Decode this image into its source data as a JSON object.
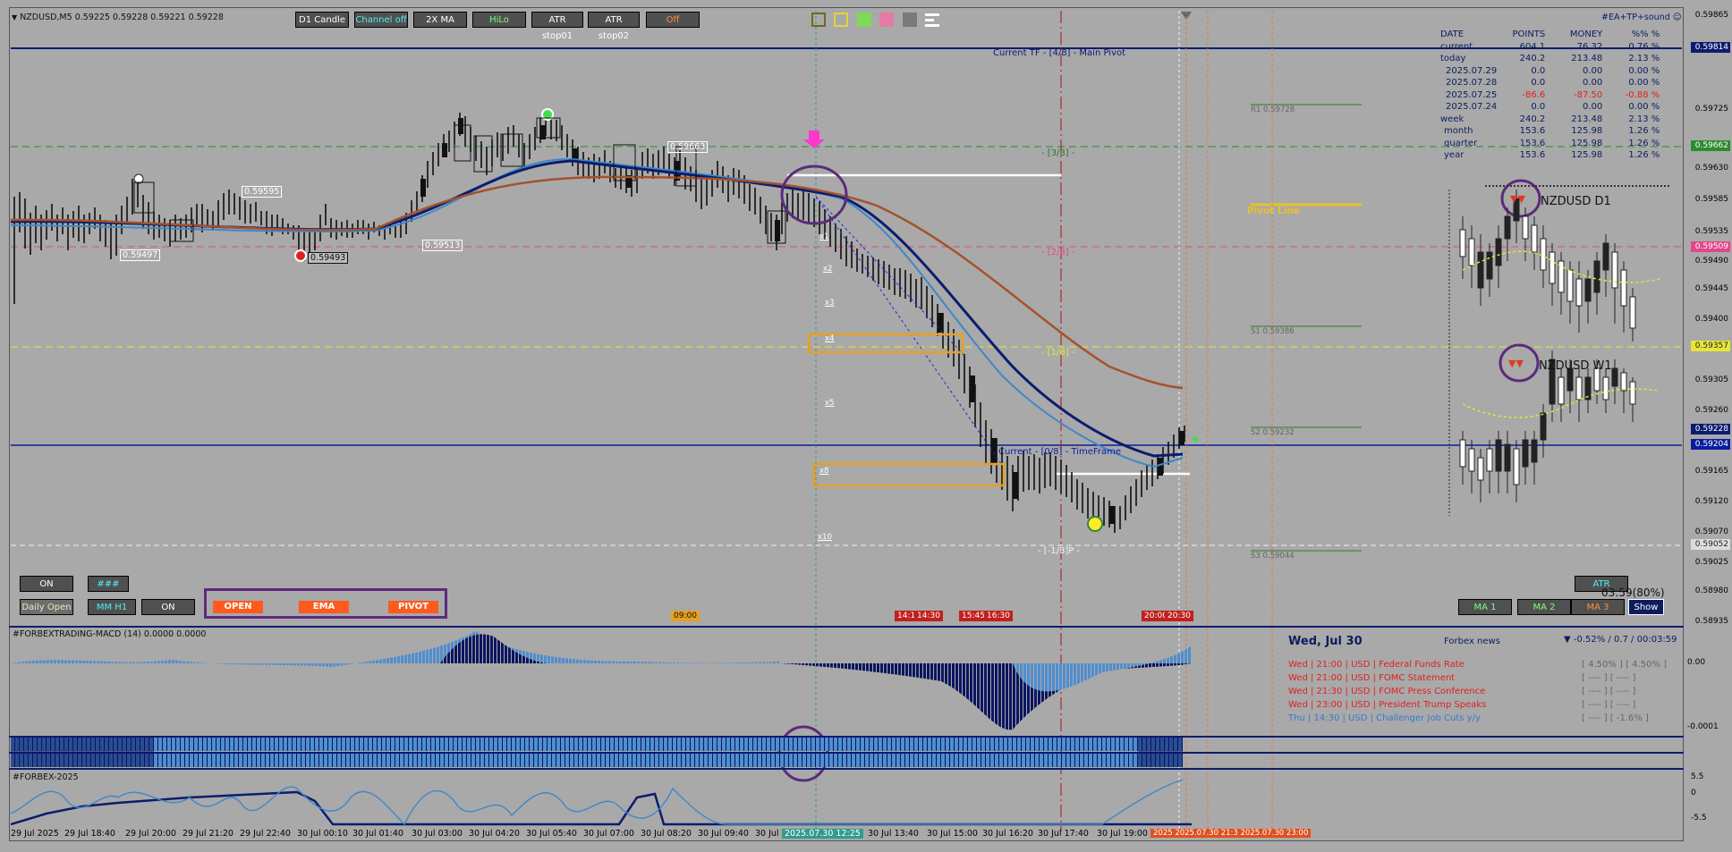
{
  "header": {
    "symbol_line": "NZDUSD,M5  0.59225 0.59228 0.59221 0.59228",
    "ea_label": "#EA+TP+sound"
  },
  "toolbar": {
    "d1_candle": "D1 Candle",
    "channel_off": "Channel off",
    "ma2x": "2X MA",
    "hilo": "HiLo",
    "atr_stop01": "ATR stop01",
    "atr_stop02": "ATR stop02",
    "off": "Off"
  },
  "chart_labels": {
    "main_pivot": "Current TF - [4/8] - Main Pivot",
    "current_tf": "Current - [0/8] - TimeFrame",
    "m38": "- [3/8] -",
    "m28": "- [2/8] -",
    "m18": "- [1/8] -",
    "m_18": "- [-1/8]P -",
    "r1": "R1 0.59728",
    "pivot_line": "Pivot Line",
    "s1": "S1 0.59386",
    "s2": "S2 0.59232",
    "s3": "S3 0.59044",
    "low1": "0.59497",
    "low2": "0.59493",
    "mid1": "0.59513",
    "hi1": "0.59595",
    "hi2": "0.59663",
    "x_labels": [
      "x1",
      "x2",
      "x3",
      "x4",
      "x5",
      "x8",
      "x10"
    ],
    "d1_title": "NZDUSD D1",
    "w1_title": "NZDUSD W1",
    "atr_value": "03:59(80%)"
  },
  "stats": {
    "headers": [
      "DATE",
      "POINTS",
      "MONEY",
      "%%  %"
    ],
    "rows": [
      [
        "current",
        "604.1",
        "76.32",
        "0.76 %"
      ],
      [
        "today",
        "240.2",
        "213.48",
        "2.13 %"
      ],
      [
        "2025.07.29",
        "0.0",
        "0.00",
        "0.00 %"
      ],
      [
        "2025.07.28",
        "0.0",
        "0.00",
        "0.00 %"
      ],
      [
        "2025.07.25",
        "-86.6",
        "-87.50",
        "-0.88 %"
      ],
      [
        "2025.07.24",
        "0.0",
        "0.00",
        "0.00 %"
      ],
      [
        "week",
        "240.2",
        "213.48",
        "2.13 %"
      ],
      [
        "month",
        "153.6",
        "125.98",
        "1.26 %"
      ],
      [
        "quarter",
        "153.6",
        "125.98",
        "1.26 %"
      ],
      [
        "year",
        "153.6",
        "125.98",
        "1.26 %"
      ]
    ]
  },
  "price_axis": {
    "labels": [
      "0.59865",
      "0.59814",
      "0.59725",
      "0.59662",
      "0.59630",
      "0.59585",
      "0.59535",
      "0.59490",
      "0.59445",
      "0.59400",
      "0.59357",
      "0.59305",
      "0.59260",
      "0.59228",
      "0.59204",
      "0.59165",
      "0.59120",
      "0.59070",
      "0.59052",
      "0.59025",
      "0.58980",
      "0.58935"
    ],
    "box_current": "0.59228",
    "box_main_pivot": "0.59814",
    "box_green": "0.59662",
    "box_pink": "0.59509",
    "box_yellow": "0.59357",
    "box_blue": "0.59204",
    "box_white": "0.59052"
  },
  "bottom_buttons": {
    "on1": "ON",
    "hash": "###",
    "daily_open": "Daily Open",
    "mm_h1": "MM H1",
    "on2": "ON",
    "open": "OPEN",
    "ema": "EMA",
    "pivot": "PIVOT",
    "ma1": "MA 1",
    "ma2": "MA 2",
    "ma3": "MA 3",
    "show": "Show",
    "atr": "ATR"
  },
  "session_tags": [
    "09:00",
    "14:15",
    "14:30",
    "15:45",
    "16:30",
    "20:00",
    "20:30"
  ],
  "macd": {
    "title": "#FORBEXTRADING-MACD (14) 0.0000 0.0000",
    "axis": [
      "0.00",
      "0.00",
      "-0.0001"
    ]
  },
  "forbex": {
    "title": "#FORBEX-2025",
    "axis": [
      "5.5",
      "0",
      "-5.5"
    ]
  },
  "news": {
    "date": "Wed, Jul 30",
    "source": "Forbex news",
    "change": "▼ -0.52% / 0.7 / 00:03:59",
    "items": [
      {
        "text": "Wed  |  21:00  |  USD  |  Federal Funds Rate",
        "values": "[ 4.50% ]    [ 4.50% ]"
      },
      {
        "text": "Wed  |  21:00  |  USD  |  FOMC Statement",
        "values": "[ ---- ]    [ ---- ]"
      },
      {
        "text": "Wed  |  21:30  |  USD  |  FOMC Press Conference",
        "values": "[ ---- ]    [ ---- ]"
      },
      {
        "text": "Wed  |  23:00  |  USD  |  President Trump Speaks",
        "values": "[ ---- ]    [ ---- ]"
      },
      {
        "text": "Thu  |  14:30  |  USD  |  Challenger Job Cuts y/y",
        "values": "[ ---- ]    [ -1.6% ]"
      }
    ]
  },
  "time_axis": [
    "29 Jul 2025",
    "29 Jul 18:40",
    "29 Jul 20:00",
    "29 Jul 21:20",
    "29 Jul 22:40",
    "30 Jul 00:10",
    "30 Jul 01:40",
    "30 Jul 03:00",
    "30 Jul 04:20",
    "30 Jul 05:40",
    "30 Jul 07:00",
    "30 Jul 08:20",
    "30 Jul 09:40",
    "30 Jul",
    "2025.07.30 12:25",
    "30 Jul 13:40",
    "30 Jul 15:00",
    "30 Jul 16:20",
    "30 Jul 17:40",
    "30 Jul 19:00"
  ],
  "time_tags": {
    "red": "2025 2025.07.30 21:3 2025.07.30 23:00"
  },
  "colors": {
    "background": "#a9a9a9",
    "ema_dark": "#0b1d6e",
    "ema_light": "#3f87c8",
    "ema_brown": "#a5522a",
    "macd_dark": "#0b1560",
    "macd_light": "#4f8ed0"
  }
}
